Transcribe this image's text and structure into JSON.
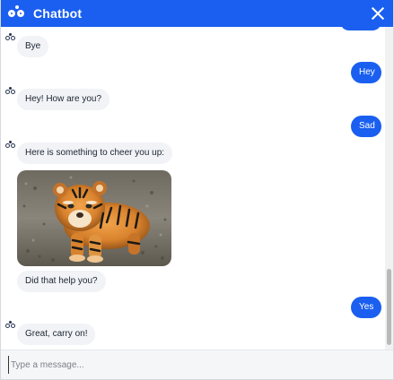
{
  "header": {
    "title": "Chatbot",
    "icon": "robot-eyes-icon",
    "close_icon": "close-icon"
  },
  "messages": [
    {
      "from": "bot",
      "text": "Bye"
    },
    {
      "from": "user",
      "text": "Hey"
    },
    {
      "from": "bot",
      "text": "Hey! How are you?"
    },
    {
      "from": "user",
      "text": "Sad"
    },
    {
      "from": "bot",
      "text": "Here is something to cheer you up:"
    },
    {
      "from": "bot",
      "type": "image",
      "subject": "tiger cub"
    },
    {
      "from": "bot",
      "text": "Did that help you?"
    },
    {
      "from": "user",
      "text": "Yes"
    },
    {
      "from": "bot",
      "text": "Great, carry on!"
    }
  ],
  "composer": {
    "placeholder": "Type a message..."
  },
  "colors": {
    "accent": "#1a5ff0",
    "bot_bubble": "#f1f3f6",
    "user_bubble": "#1a5ff0"
  }
}
